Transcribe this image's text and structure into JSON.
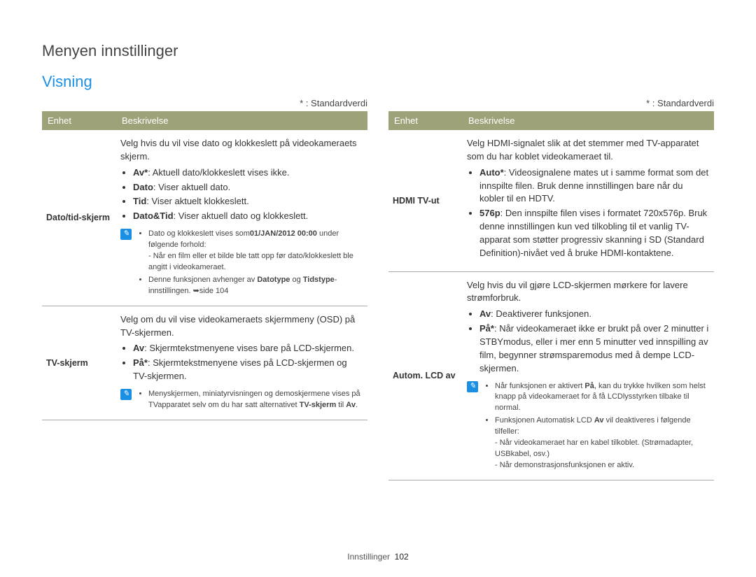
{
  "breadcrumb": "Menyen innstillinger",
  "section": "Visning",
  "default_note": "* : Standardverdi",
  "headers": {
    "unit": "Enhet",
    "desc": "Beskrivelse"
  },
  "footer": {
    "section": "Innstillinger",
    "page": "102"
  },
  "note_icon_glyph": "✎",
  "left": [
    {
      "unit": "Dato/tid-skjerm",
      "intro": "Velg hvis du vil vise dato og klokkeslett på videokameraets skjerm.",
      "bullets": [
        {
          "strong": "Av*",
          "text": ": Aktuell dato/klokkeslett vises ikke."
        },
        {
          "strong": "Dato",
          "text": ": Viser aktuell dato."
        },
        {
          "strong": "Tid",
          "text": ": Viser aktuelt klokkeslett."
        },
        {
          "strong": "Dato&Tid",
          "text": ": Viser aktuell dato og klokkeslett."
        }
      ],
      "notes": [
        {
          "line": "Dato og klokkeslett vises som",
          "strong": "01/JAN/2012 00:00",
          "tail": " under følgende forhold:",
          "subs": [
            "- Når en film eller et bilde ble tatt opp før dato/klokkeslett ble angitt i videokameraet."
          ]
        },
        {
          "line": "Denne funksjonen avhenger av ",
          "strong": "Datotype",
          "tail": " og ",
          "strong2": "Tidstype",
          "tail2": "-innstillingen. ➥side 104"
        }
      ]
    },
    {
      "unit": "TV-skjerm",
      "intro": "Velg om du vil vise videokameraets skjermmeny (OSD) på TV-skjermen.",
      "bullets": [
        {
          "strong": "Av",
          "text": ": Skjermtekstmenyene vises bare på LCD-skjermen."
        },
        {
          "strong": "På*",
          "text": ": Skjermtekstmenyene vises på LCD-skjermen og TV-skjermen."
        }
      ],
      "notes": [
        {
          "line": "Menyskjermen, miniatyrvisningen og demoskjermene vises på TVapparatet selv om du har satt alternativet ",
          "strong": "TV-skjerm",
          "tail": " til ",
          "strong2": "Av",
          "tail2": "."
        }
      ]
    }
  ],
  "right": [
    {
      "unit": "HDMI TV-ut",
      "intro": "Velg HDMI-signalet slik at det stemmer med TV-apparatet som du har koblet videokameraet til.",
      "bullets": [
        {
          "strong": "Auto*",
          "text": ": Videosignalene mates ut i samme format som det innspilte filen. Bruk denne innstillingen bare når du kobler til en HDTV."
        },
        {
          "strong": "576p",
          "text": ": Den innspilte filen vises i formatet 720x576p. Bruk denne innstillingen kun ved tilkobling til et vanlig TV-apparat som støtter progressiv skanning i SD (Standard Definition)-nivået ved å bruke HDMI-kontaktene."
        }
      ]
    },
    {
      "unit": "Autom. LCD av",
      "intro": "Velg hvis du vil gjøre LCD-skjermen mørkere for lavere strømforbruk.",
      "bullets": [
        {
          "strong": "Av",
          "text": ": Deaktiverer funksjonen."
        },
        {
          "strong": "På*",
          "text": ": Når videokameraet ikke er brukt på over 2 minutter i STBYmodus, eller i mer enn 5 minutter ved innspilling av film, begynner strømsparemodus med å dempe LCD-skjermen."
        }
      ],
      "notes": [
        {
          "line": "Når funksjonen er aktivert ",
          "strong": "På",
          "tail": ", kan du trykke hvilken som helst knapp på videokameraet for å få LCDlysstyrken tilbake til normal."
        },
        {
          "line": "Funksjonen Automatisk LCD ",
          "strong": "Av",
          "tail": " vil deaktiveres i følgende tilfeller:",
          "subs": [
            "- Når videokameraet har en kabel tilkoblet. (Strømadapter, USBkabel, osv.)",
            "- Når demonstrasjonsfunksjonen er aktiv."
          ]
        }
      ]
    }
  ]
}
